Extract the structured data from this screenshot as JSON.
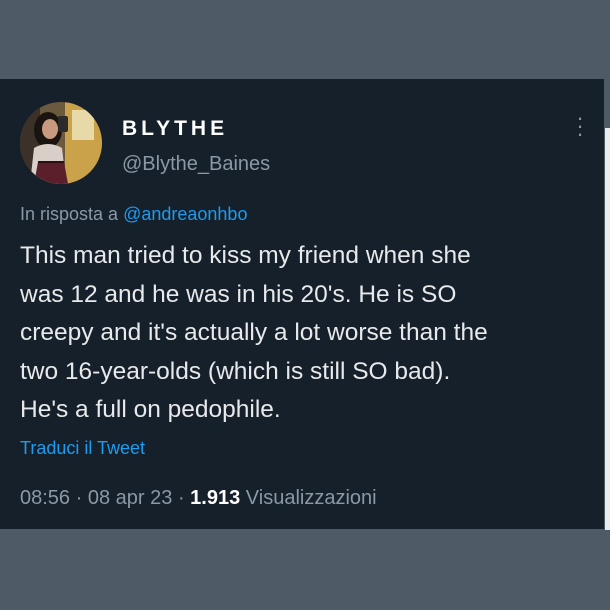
{
  "tweet": {
    "display_name": "BLYTHE",
    "handle": "@Blythe_Baines",
    "reply_prefix": "In risposta a",
    "reply_mention": "@andreaonhbo",
    "text_lines": [
      "This man tried to kiss my friend when she",
      "was 12 and he was in his 20's. He is SO",
      "creepy and it's actually a lot worse than the",
      "two 16-year-olds (which is still SO bad).",
      "He's a full on pedophile."
    ],
    "translate_label": "Traduci il Tweet",
    "time": "08:56",
    "date": "08 apr 23",
    "separator": "·",
    "views_count": "1.913",
    "views_label": "Visualizzazioni",
    "more_icon": "more-vertical-icon",
    "colors": {
      "background": "#15202b",
      "outer": "#4e5a66",
      "link": "#1d9bf0",
      "secondary": "#8b98a5",
      "primary_text": "#e7e9ea"
    }
  }
}
